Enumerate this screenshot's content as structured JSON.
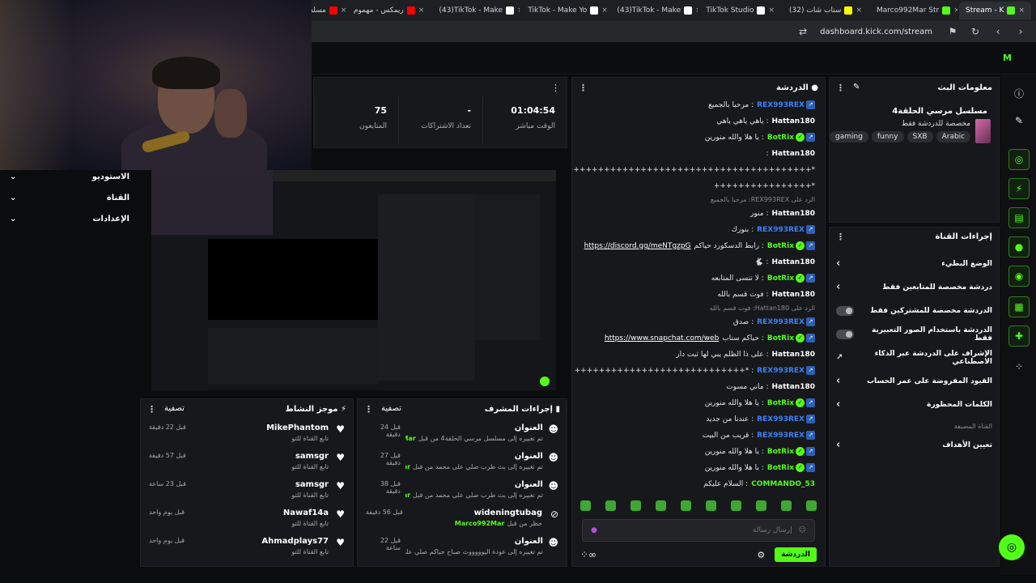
{
  "browser": {
    "tabs": [
      {
        "label": "مسلسل المرسي ال",
        "color": "#ff0000"
      },
      {
        "label": "ريمكس - مهموم",
        "color": "#ff0000"
      },
      {
        "label": "(43)TikTok - Make",
        "color": "#ffffff"
      },
      {
        "label": "TikTok - Make Yo",
        "color": "#ffffff"
      },
      {
        "label": "(43)TikTok - Make",
        "color": "#ffffff"
      },
      {
        "label": "TikTok Studio",
        "color": "#ffffff"
      },
      {
        "label": "(32) سناب شات",
        "color": "#fffc00"
      },
      {
        "label": "Marco992Mar Str",
        "color": "#53fc18"
      },
      {
        "label": "Stream - K",
        "color": "#53fc18"
      }
    ],
    "url": "dashboard.kick.com/stream"
  },
  "logo": "M",
  "stream_info": {
    "header": "معلومات البث",
    "title": "مسلسل مرسي الحلقة4",
    "category": "مخصصة للدردشة فقط",
    "tags": [
      "Arabic",
      "SXB",
      "funny",
      "gaming"
    ]
  },
  "channel_actions": {
    "header": "إجراءات القناة",
    "items": [
      {
        "label": "الوضع البطيء",
        "type": "chevron"
      },
      {
        "label": "دردشة مخصصة للمتابعين فقط",
        "type": "chevron"
      },
      {
        "label": "الدردشة مخصصة للمشتركين فقط",
        "type": "toggle"
      },
      {
        "label": "الدردشة باستخدام الصور التعبيرية فقط",
        "type": "toggle"
      },
      {
        "label": "الإشراف على الدردشة عبر الذكاء الاصطناعي",
        "type": "external"
      },
      {
        "label": "القيود المفروضة على عمر الحساب",
        "type": "chevron"
      },
      {
        "label": "الكلمات المحظورة",
        "type": "chevron"
      }
    ],
    "section_label": "القناة المضيفة",
    "goals": "تعيين الأهداف"
  },
  "chat": {
    "header": "الدردشة",
    "messages": [
      {
        "user": "REX993REX",
        "text": "مرحبا بالجميع",
        "color": "#3b82f6",
        "badge": "blue"
      },
      {
        "user": "Hattan180",
        "text": "ياهي ياهي ياهي",
        "color": "#ffffff",
        "badge": ""
      },
      {
        "user": "BotRix",
        "text": "يا هلا والله منورين",
        "color": "#53fc18",
        "badge": "green"
      },
      {
        "user": "Hattan180",
        "text": "",
        "color": "#ffffff",
        "badge": ""
      },
      {
        "user": "",
        "text": "*++++++++++++++++++++++++++++++++++++++++++++++++++++++",
        "color": "#ffffff",
        "badge": ""
      },
      {
        "user": "",
        "text": "*++++++++++++++++",
        "color": "#ffffff",
        "badge": ""
      },
      {
        "user": "",
        "text": "الرد على REX993REX: مرحبا بالجميع",
        "color": "#888888",
        "badge": "reply"
      },
      {
        "user": "Hattan180",
        "text": "منور",
        "color": "#ffffff",
        "badge": ""
      },
      {
        "user": "REX993REX",
        "text": "بنورك",
        "color": "#3b82f6",
        "badge": "blue"
      },
      {
        "user": "BotRix",
        "text": "رابط الدسكورد حياكم",
        "link": "https://discord.gg/meNTgzpG",
        "color": "#53fc18",
        "badge": "green"
      },
      {
        "user": "Hattan180",
        "text": "🐇",
        "color": "#ffffff",
        "badge": ""
      },
      {
        "user": "BotRix",
        "text": "لا تنسى المتابعه",
        "color": "#53fc18",
        "badge": "green"
      },
      {
        "user": "Hattan180",
        "text": "فوت قسم بالله",
        "color": "#ffffff",
        "badge": ""
      },
      {
        "user": "",
        "text": "الرد على Hattan180: فوت قسم بالله",
        "color": "#888888",
        "badge": "reply"
      },
      {
        "user": "REX993REX",
        "text": "صدق",
        "color": "#3b82f6",
        "badge": "blue"
      },
      {
        "user": "BotRix",
        "text": "حياكم سناب",
        "link": "https://www.snapchat.com/web",
        "color": "#53fc18",
        "badge": "green"
      },
      {
        "user": "Hattan180",
        "text": "على ذا الظلم يبي لها ثبت دار",
        "color": "#ffffff",
        "badge": ""
      },
      {
        "user": "REX993REX",
        "text": "*++++++++++++++++++++++++++++",
        "color": "#3b82f6",
        "badge": "blue"
      },
      {
        "user": "Hattan180",
        "text": "ماني مسوت",
        "color": "#ffffff",
        "badge": ""
      },
      {
        "user": "BotRix",
        "text": "يا هلا والله منورين",
        "color": "#53fc18",
        "badge": "green"
      },
      {
        "user": "REX993REX",
        "text": "عندنا من جديد",
        "color": "#3b82f6",
        "badge": "blue"
      },
      {
        "user": "REX993REX",
        "text": "قريب من البيت",
        "color": "#3b82f6",
        "badge": "blue"
      },
      {
        "user": "BotRix",
        "text": "يا هلا والله منورين",
        "color": "#53fc18",
        "badge": "green"
      },
      {
        "user": "BotRix",
        "text": "يا هلا والله منورين",
        "color": "#53fc18",
        "badge": "green"
      },
      {
        "user": "COMMANDO_53",
        "text": "السلام عليكم",
        "color": "#53fc18",
        "badge": ""
      },
      {
        "user": "BotRix",
        "text": "يا هلا والله منورين",
        "color": "#53fc18",
        "badge": "green"
      }
    ],
    "input_placeholder": "إرسال رسالة",
    "send_label": "الدردشة"
  },
  "stats": [
    {
      "value": "01:04:54",
      "label": "الوقت مباشر"
    },
    {
      "value": "-",
      "label": "تعداد الاشتراكات"
    },
    {
      "value": "75",
      "label": "المتابعون"
    }
  ],
  "left_nav": [
    {
      "label": "الاستوديو"
    },
    {
      "label": "القناة"
    },
    {
      "label": "الإعدادات"
    }
  ],
  "mod_actions": {
    "header": "إجراءات المشرف",
    "filter": "تصفية",
    "items": [
      {
        "title": "العنوان",
        "desc": "تم تغييره إلى مسلسل مرسي الحلقة4 من قبل",
        "by": "Marco992Mar",
        "time": "قبل 24 دقيقة"
      },
      {
        "title": "العنوان",
        "desc": "تم تغييره إلى بث طرب صلي على محمد من قبل",
        "by": "Marco992Mar",
        "time": "قبل 27 دقيقة"
      },
      {
        "title": "العنوان",
        "desc": "تم تغييره إلى بث طرب صلي على محمد من قبل",
        "by": "Marco992Mar",
        "time": "قبل 38 دقيقة"
      },
      {
        "title": "wideningtubag",
        "desc": "حظر من قبل",
        "by": "Marco992Mar",
        "time": "قبل 56 دقيقة"
      },
      {
        "title": "العنوان",
        "desc": "تم تغييره إلى عودة اليوووووث صباح حياكم صلي على محمد من قبل",
        "by": "Marco992Mar",
        "time": "قبل 22 ساعة"
      }
    ]
  },
  "activity": {
    "header": "موجز النشاط",
    "filter": "تصفية",
    "items": [
      {
        "name": "MikePhantom",
        "sub": "تابع القناة للتو",
        "time": "قبل 22 دقيقة"
      },
      {
        "name": "samsgr",
        "sub": "تابع القناة للتو",
        "time": "قبل 57 دقيقة"
      },
      {
        "name": "samsgr",
        "sub": "تابع القناة للتو",
        "time": "قبل 23 ساعة"
      },
      {
        "name": "Nawaf14a",
        "sub": "تابع القناة للتو",
        "time": "قبل يوم واحد"
      },
      {
        "name": "Ahmadplays77",
        "sub": "تابع القناة للتو",
        "time": "قبل يوم واحد"
      }
    ]
  }
}
